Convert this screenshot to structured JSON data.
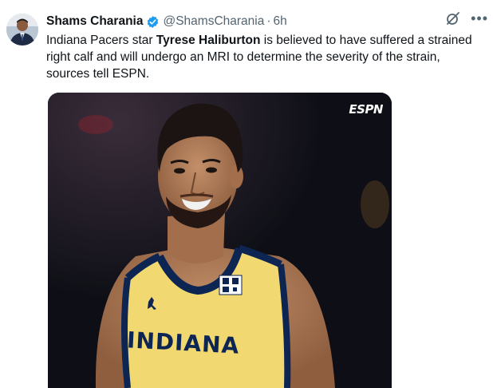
{
  "post": {
    "author_name": "Shams Charania",
    "author_handle": "@ShamsCharania",
    "separator": "·",
    "time_ago": "6h",
    "text_before": "Indiana Pacers star ",
    "text_bold": "Tyrese Haliburton",
    "text_after": " is believed to have suffered a strained right calf and will undergo an MRI to determine the severity of the strain, sources tell ESPN."
  },
  "media": {
    "brand_logo": "ESPN",
    "jersey_text": "INDIANA"
  },
  "icons": {
    "verified": "verified-badge-icon",
    "grok": "grok-icon",
    "more": "more-icon"
  },
  "colors": {
    "verified_blue": "#1d9bf0",
    "secondary_text": "#536471",
    "jersey_gold": "#f1d871",
    "jersey_navy": "#0d2552"
  }
}
